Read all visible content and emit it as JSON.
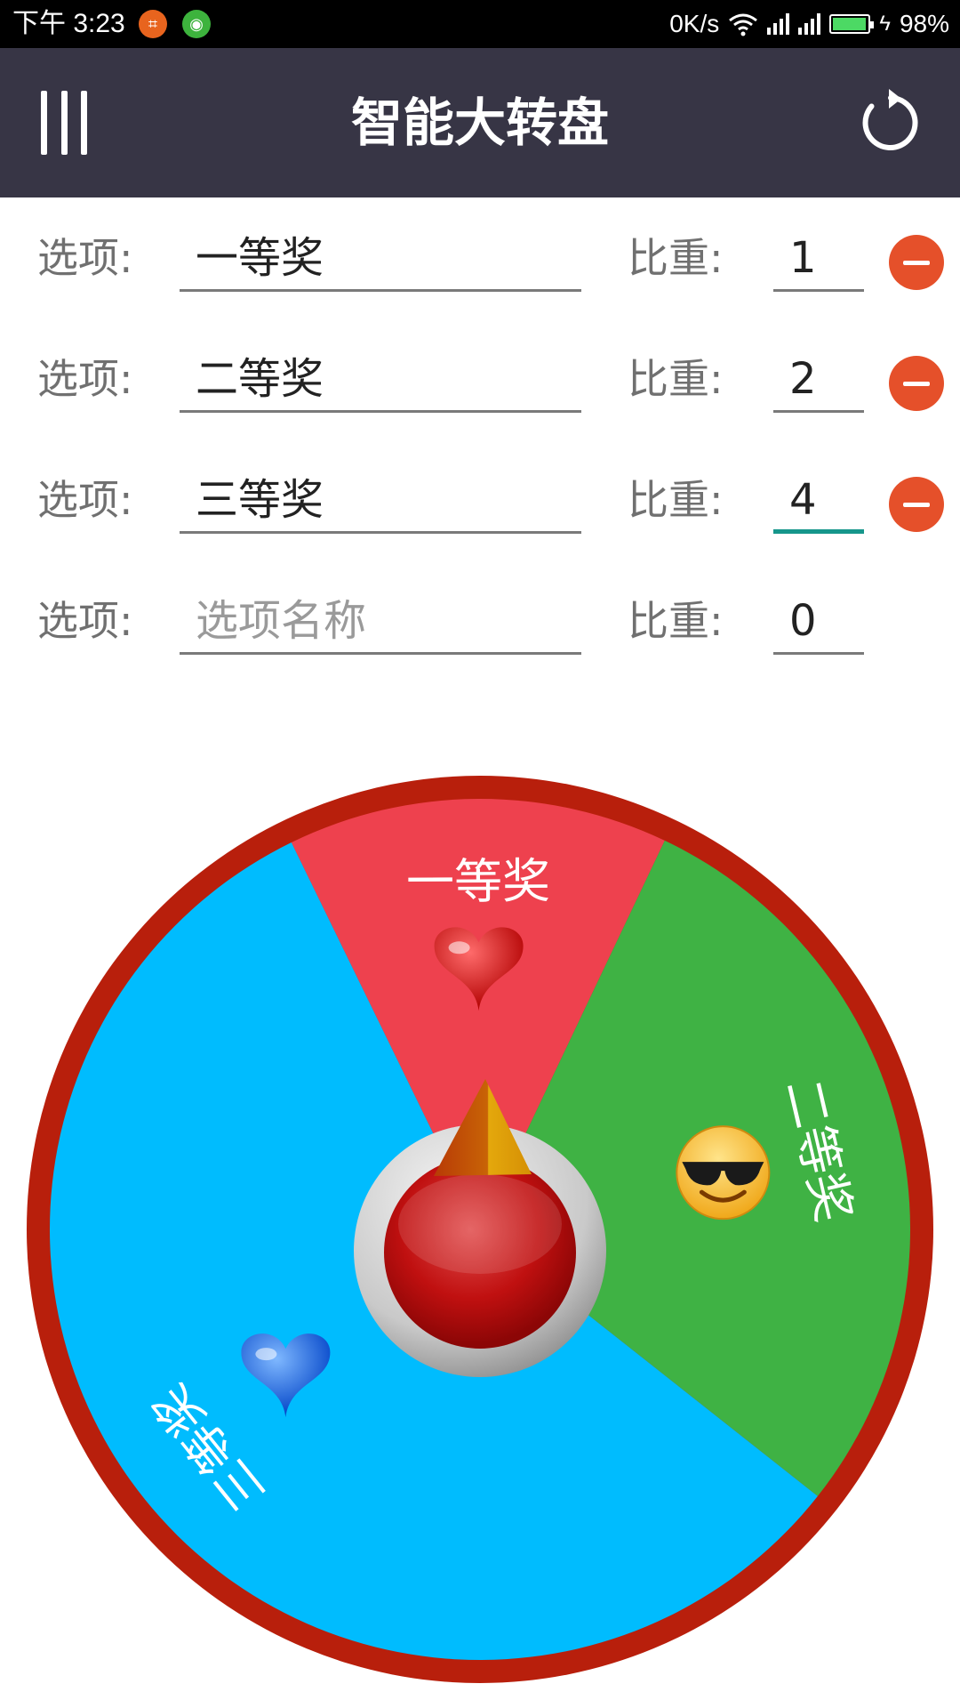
{
  "status_bar": {
    "time": "下午 3:23",
    "net_speed": "0K/s",
    "battery_level": "98%",
    "battery_fraction": 0.98,
    "app_icons": [
      "crop-icon",
      "android-icon"
    ],
    "app_icon_colors": [
      "#E8641E",
      "#3DB33D"
    ]
  },
  "header": {
    "title": "智能大转盘",
    "menu_icon": "menu-icon",
    "refresh_icon": "refresh-icon",
    "background": "#373545"
  },
  "form": {
    "option_label": "选项:",
    "weight_label": "比重:",
    "rows": [
      {
        "name": "一等奖",
        "weight": "1",
        "removable": true
      },
      {
        "name": "二等奖",
        "weight": "2",
        "removable": true
      },
      {
        "name": "三等奖",
        "weight": "4",
        "removable": true,
        "focused": true
      },
      {
        "name": "",
        "placeholder": "选项名称",
        "weight": "0",
        "removable": false
      }
    ],
    "remove_color": "#E5502A",
    "focus_color": "#16968B"
  },
  "wheel": {
    "rim_color": "#B81F0C",
    "segments": [
      {
        "label": "一等奖",
        "weight": 1,
        "color": "#EE414E",
        "icon": "heart-red-icon"
      },
      {
        "label": "二等奖",
        "weight": 2,
        "color": "#3FB244",
        "icon": "sunglasses-smiley-icon"
      },
      {
        "label": "三等奖",
        "weight": 4,
        "color": "#00BCFE",
        "icon": "heart-blue-icon"
      }
    ],
    "start_button_color": "#C20F0F",
    "pointer_color": "#E0A000"
  }
}
